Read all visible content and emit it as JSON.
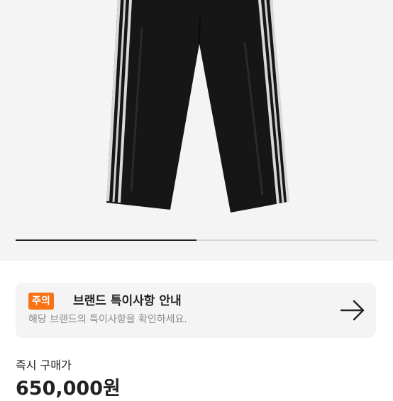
{
  "product_image": {
    "description_icon": "track-pants-photo",
    "slide_progress": 0.5
  },
  "notice": {
    "badge": "주의",
    "badge_color": "#f97316",
    "title": "브랜드 특이사항 안내",
    "description": "해당 브랜드의 특이사항을 확인하세요.",
    "action_icon": "arrow-right-icon"
  },
  "purchase": {
    "label": "즉시 구매가",
    "price": "650,000원"
  }
}
